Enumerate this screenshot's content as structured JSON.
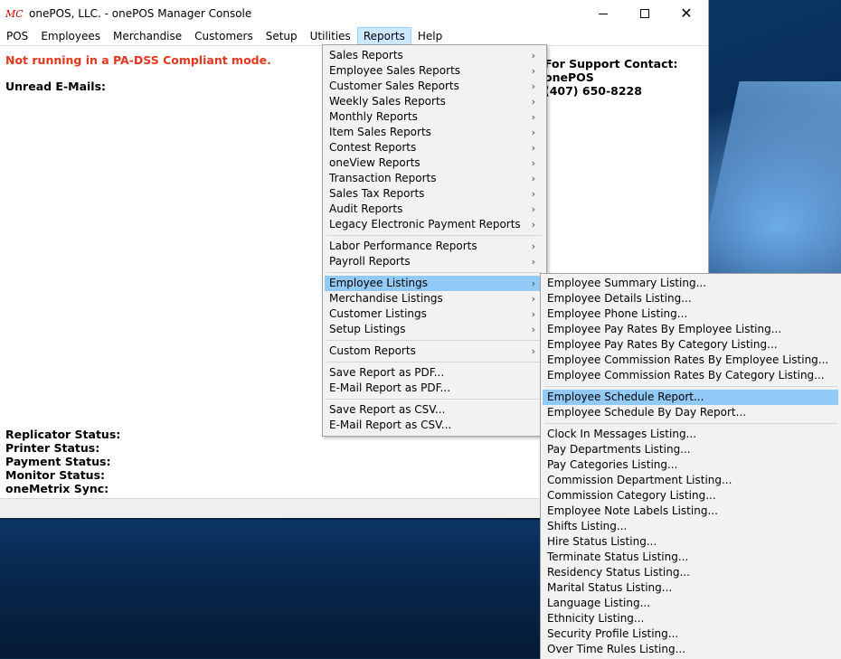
{
  "window": {
    "icon_text": "MC",
    "title": "onePOS, LLC. - onePOS Manager Console"
  },
  "menubar": [
    {
      "label": "POS"
    },
    {
      "label": "Employees"
    },
    {
      "label": "Merchandise"
    },
    {
      "label": "Customers"
    },
    {
      "label": "Setup"
    },
    {
      "label": "Utilities"
    },
    {
      "label": "Reports",
      "active": true
    },
    {
      "label": "Help"
    }
  ],
  "content": {
    "warning": "Not running in a PA-DSS Compliant mode.",
    "unread": "Unread E-Mails:",
    "support": {
      "line1": "For Support Contact:",
      "line2": "onePOS",
      "line3": "(407) 650-8228"
    },
    "statuses": [
      "Replicator Status:",
      "Printer Status:",
      "Payment Status:",
      "Monitor Status:",
      "oneMetrix Sync:"
    ]
  },
  "reports_menu": {
    "groups": [
      [
        {
          "label": "Sales Reports",
          "submenu": true
        },
        {
          "label": "Employee Sales Reports",
          "submenu": true
        },
        {
          "label": "Customer Sales Reports",
          "submenu": true
        },
        {
          "label": "Weekly Sales Reports",
          "submenu": true
        },
        {
          "label": "Monthly Reports",
          "submenu": true
        },
        {
          "label": "Item Sales Reports",
          "submenu": true
        },
        {
          "label": "Contest Reports",
          "submenu": true
        },
        {
          "label": "oneView Reports",
          "submenu": true
        },
        {
          "label": "Transaction Reports",
          "submenu": true
        },
        {
          "label": "Sales Tax Reports",
          "submenu": true
        },
        {
          "label": "Audit Reports",
          "submenu": true
        },
        {
          "label": "Legacy Electronic Payment Reports",
          "submenu": true
        }
      ],
      [
        {
          "label": "Labor Performance Reports",
          "submenu": true
        },
        {
          "label": "Payroll Reports",
          "submenu": true
        }
      ],
      [
        {
          "label": "Employee Listings",
          "submenu": true,
          "highlighted": true
        },
        {
          "label": "Merchandise Listings",
          "submenu": true
        },
        {
          "label": "Customer Listings",
          "submenu": true
        },
        {
          "label": "Setup Listings",
          "submenu": true
        }
      ],
      [
        {
          "label": "Custom Reports",
          "submenu": true
        }
      ],
      [
        {
          "label": "Save Report as PDF...",
          "submenu": false
        },
        {
          "label": "E-Mail Report as PDF...",
          "submenu": false
        }
      ],
      [
        {
          "label": "Save Report as CSV...",
          "submenu": false
        },
        {
          "label": "E-Mail Report as CSV...",
          "submenu": false
        }
      ]
    ]
  },
  "listings_menu": {
    "groups": [
      [
        {
          "label": "Employee Summary Listing..."
        },
        {
          "label": "Employee Details Listing..."
        },
        {
          "label": "Employee Phone Listing..."
        },
        {
          "label": "Employee Pay Rates By Employee Listing..."
        },
        {
          "label": "Employee Pay Rates By Category Listing..."
        },
        {
          "label": "Employee Commission Rates By Employee Listing..."
        },
        {
          "label": "Employee Commission Rates By Category Listing..."
        }
      ],
      [
        {
          "label": "Employee Schedule Report...",
          "highlighted": true
        },
        {
          "label": "Employee Schedule By Day Report..."
        }
      ],
      [
        {
          "label": "Clock In Messages Listing..."
        },
        {
          "label": "Pay Departments Listing..."
        },
        {
          "label": "Pay Categories Listing..."
        },
        {
          "label": "Commission Department Listing..."
        },
        {
          "label": "Commission Category Listing..."
        },
        {
          "label": "Employee Note Labels Listing..."
        },
        {
          "label": "Shifts Listing..."
        },
        {
          "label": "Hire Status Listing..."
        },
        {
          "label": "Terminate Status Listing..."
        },
        {
          "label": "Residency Status Listing..."
        },
        {
          "label": "Marital Status Listing..."
        },
        {
          "label": "Language Listing..."
        },
        {
          "label": "Ethnicity Listing..."
        },
        {
          "label": "Security Profile Listing..."
        },
        {
          "label": "Over Time Rules Listing..."
        }
      ]
    ]
  }
}
